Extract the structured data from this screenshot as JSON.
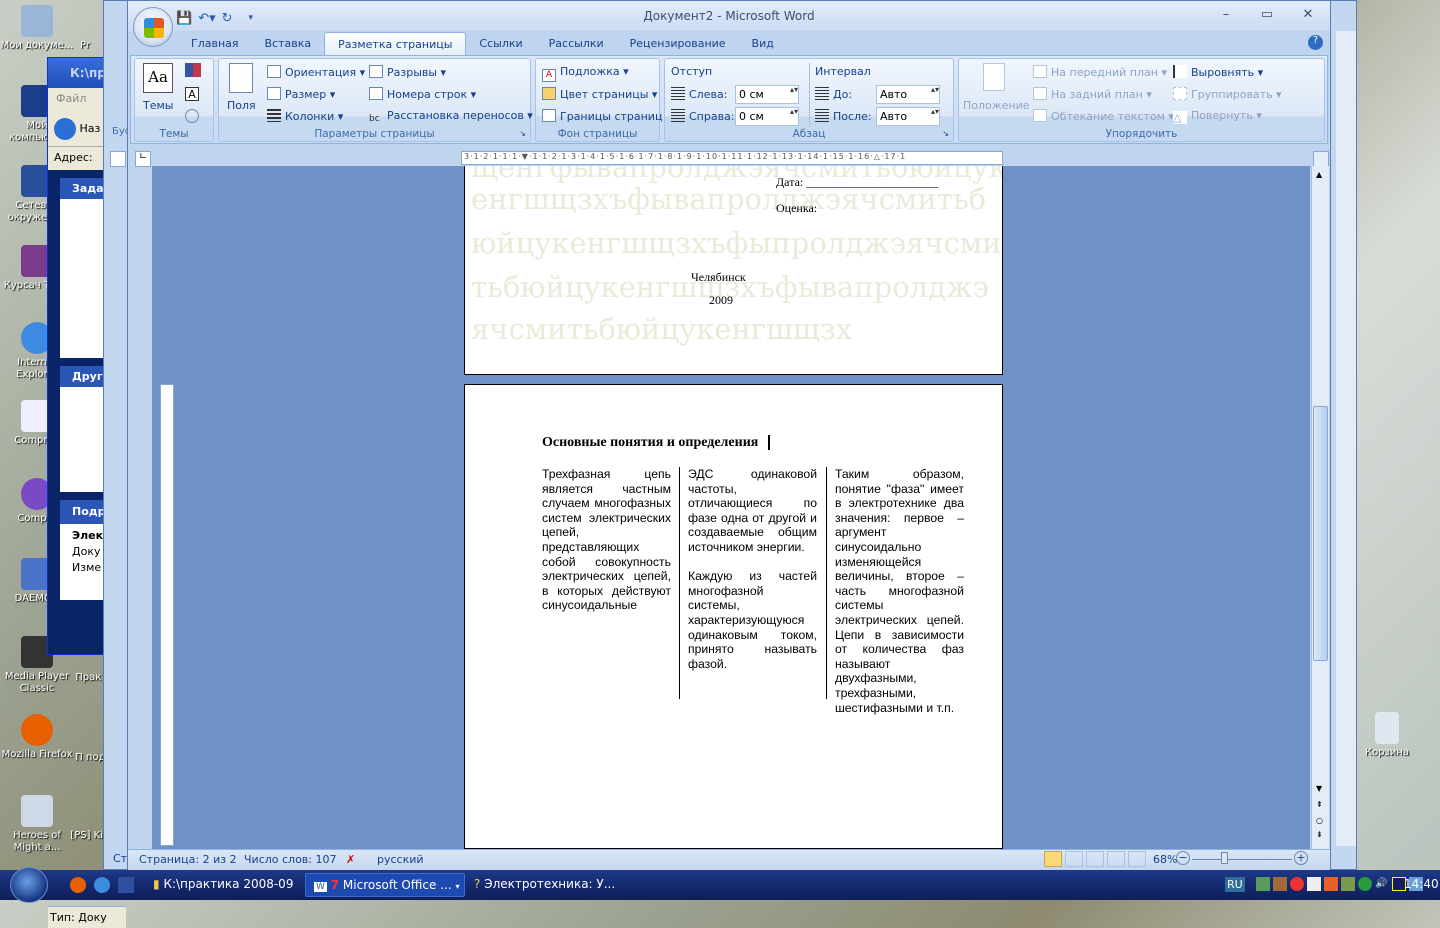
{
  "desktop": {
    "icons_left": [
      {
        "label": "Мои докуме..."
      },
      {
        "label": "Мой компьют..."
      },
      {
        "label": "Сетевое окружение"
      },
      {
        "label": "Курсач ТАУ.r"
      },
      {
        "label": "Internet Explorer"
      },
      {
        "label": "Comprob"
      },
      {
        "label": "Compro"
      },
      {
        "label": "DAEMON"
      },
      {
        "label": "Media Player Classic"
      },
      {
        "label": "Mozilla Firefox"
      },
      {
        "label": "Heroes of Might a..."
      }
    ],
    "icons_col2": [
      {
        "label": "Pr"
      },
      {
        "label": "Прак р"
      },
      {
        "label": "П подг"
      },
      {
        "label": "[PS] King"
      }
    ],
    "recycle_bin": "Корзина"
  },
  "explorer": {
    "title": "К:\\пр",
    "menu": "Файл",
    "back": "Наз",
    "address_label": "Адрес:",
    "tasks_header": "Задачи",
    "other_header": "Другие",
    "details_header": "Подр",
    "details_name": "Элек",
    "details_type": "Доку",
    "details_modified": "Изме",
    "status": "Тип: Доку"
  },
  "back_word": {
    "clipboard": "Буф",
    "status": "Ст"
  },
  "word": {
    "title": "Документ2 - Microsoft Word",
    "tabs": [
      "Главная",
      "Вставка",
      "Разметка страницы",
      "Ссылки",
      "Рассылки",
      "Рецензирование",
      "Вид"
    ],
    "active_tab": "Разметка страницы",
    "ribbon": {
      "themes": {
        "label": "Темы",
        "button": "Темы"
      },
      "page_setup": {
        "label": "Параметры страницы",
        "margins": "Поля",
        "orientation": "Ориентация",
        "size": "Размер",
        "columns": "Колонки",
        "breaks": "Разрывы",
        "line_numbers": "Номера строк",
        "hyphenation": "Расстановка переносов"
      },
      "page_background": {
        "label": "Фон страницы",
        "watermark": "Подложка",
        "page_color": "Цвет страницы",
        "page_borders": "Границы страниц"
      },
      "paragraph": {
        "label": "Абзац",
        "indent": "Отступ",
        "left_label": "Слева:",
        "left_value": "0 см",
        "right_label": "Справа:",
        "right_value": "0 см",
        "spacing": "Интервал",
        "before_label": "До:",
        "before_value": "Авто",
        "after_label": "После:",
        "after_value": "Авто"
      },
      "arrange": {
        "label": "Упорядочить",
        "position": "Положение",
        "bring_front": "На передний план",
        "send_back": "На задний план",
        "text_wrap": "Обтекание текстом",
        "align": "Выровнять",
        "group": "Группировать",
        "rotate": "Повернуть"
      }
    },
    "ruler_text": "3·1·2·1·1·1·▼·1·1·2·1·3·1·4·1·5·1·6·1·7·1·8·1·9·1·10·1·11·1·12·1·13·1·14·1·15·1·16·△·17·1",
    "page1": {
      "watermark_lines": [
        "щенгфывапролджэячсмитьбюйцук",
        "енгшщзхъфывапролджэячсмитьб",
        "юйцукенгшщзхъфыпролджэячсми",
        "тьбюйцукенгшщзхъфывапролджэ",
        "ячсмитьбюйцукенгшщзх"
      ],
      "date": "Дата: ______________________",
      "grade": "Оценка:",
      "city": "Челябинск",
      "year": "2009"
    },
    "page2": {
      "heading": "Основные понятия и определения",
      "columns": [
        [
          "Трехфазная цепь является частным случаем многофазных систем электрических цепей, представляющих собой совокупность электрических цепей, в которых действуют синусоидальные"
        ],
        [
          "ЭДС одинаковой частоты, отличающиеся по фазе одна от другой и создаваемые общим источником энергии.",
          "Каждую из частей многофазной системы, характеризующуюся одинаковым током, принято называть фазой."
        ],
        [
          "Таким образом, понятие \"фаза\" имеет в электротехнике два значения: первое – аргумент синусоидально изменяющейся величины, второе – часть многофазной системы электрических цепей. Цепи в зависимости от количества фаз называют двухфазными, трехфазными, шестифазными и т.п."
        ]
      ]
    },
    "status": {
      "page": "Страница: 2 из 2",
      "words": "Число слов: 107",
      "language": "русский",
      "zoom": "68%",
      "zoom_level": 68
    }
  },
  "taskbar": {
    "items": [
      "К:\\практика 2008-09",
      "Microsoft Office ...",
      "Электротехника: У..."
    ],
    "word_count_badge": "7",
    "lang": "RU",
    "clock": "14:40"
  }
}
